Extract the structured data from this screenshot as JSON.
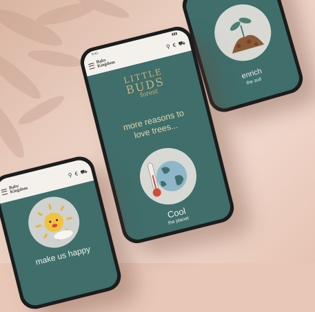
{
  "store": {
    "logo_line1": "Baby",
    "logo_line2": "Kingdom",
    "status_left": "9:41",
    "status_right": "▮▮▮"
  },
  "center_screen": {
    "brand_line1": "LITTLE",
    "brand_line2": "BUDS",
    "brand_line3": "forest",
    "headline_line1": "more reasons to",
    "headline_line2": "love trees...",
    "caption_title": "Cool",
    "caption_sub": "the planet"
  },
  "right_screen": {
    "caption_title": "enrich",
    "caption_sub": "the soil"
  },
  "left_screen": {
    "caption_title": "make us happy"
  },
  "colors": {
    "screen_teal": "#3f6e6b",
    "circle_grey": "#d8d9d5",
    "background": "#e8c7b6",
    "accent_gold": "#cdb27a"
  },
  "icons": [
    "menu-icon",
    "search-icon",
    "currency-icon",
    "cart-icon",
    "thermometer-icon",
    "globe-icon",
    "sprout-icon",
    "sun-icon"
  ]
}
